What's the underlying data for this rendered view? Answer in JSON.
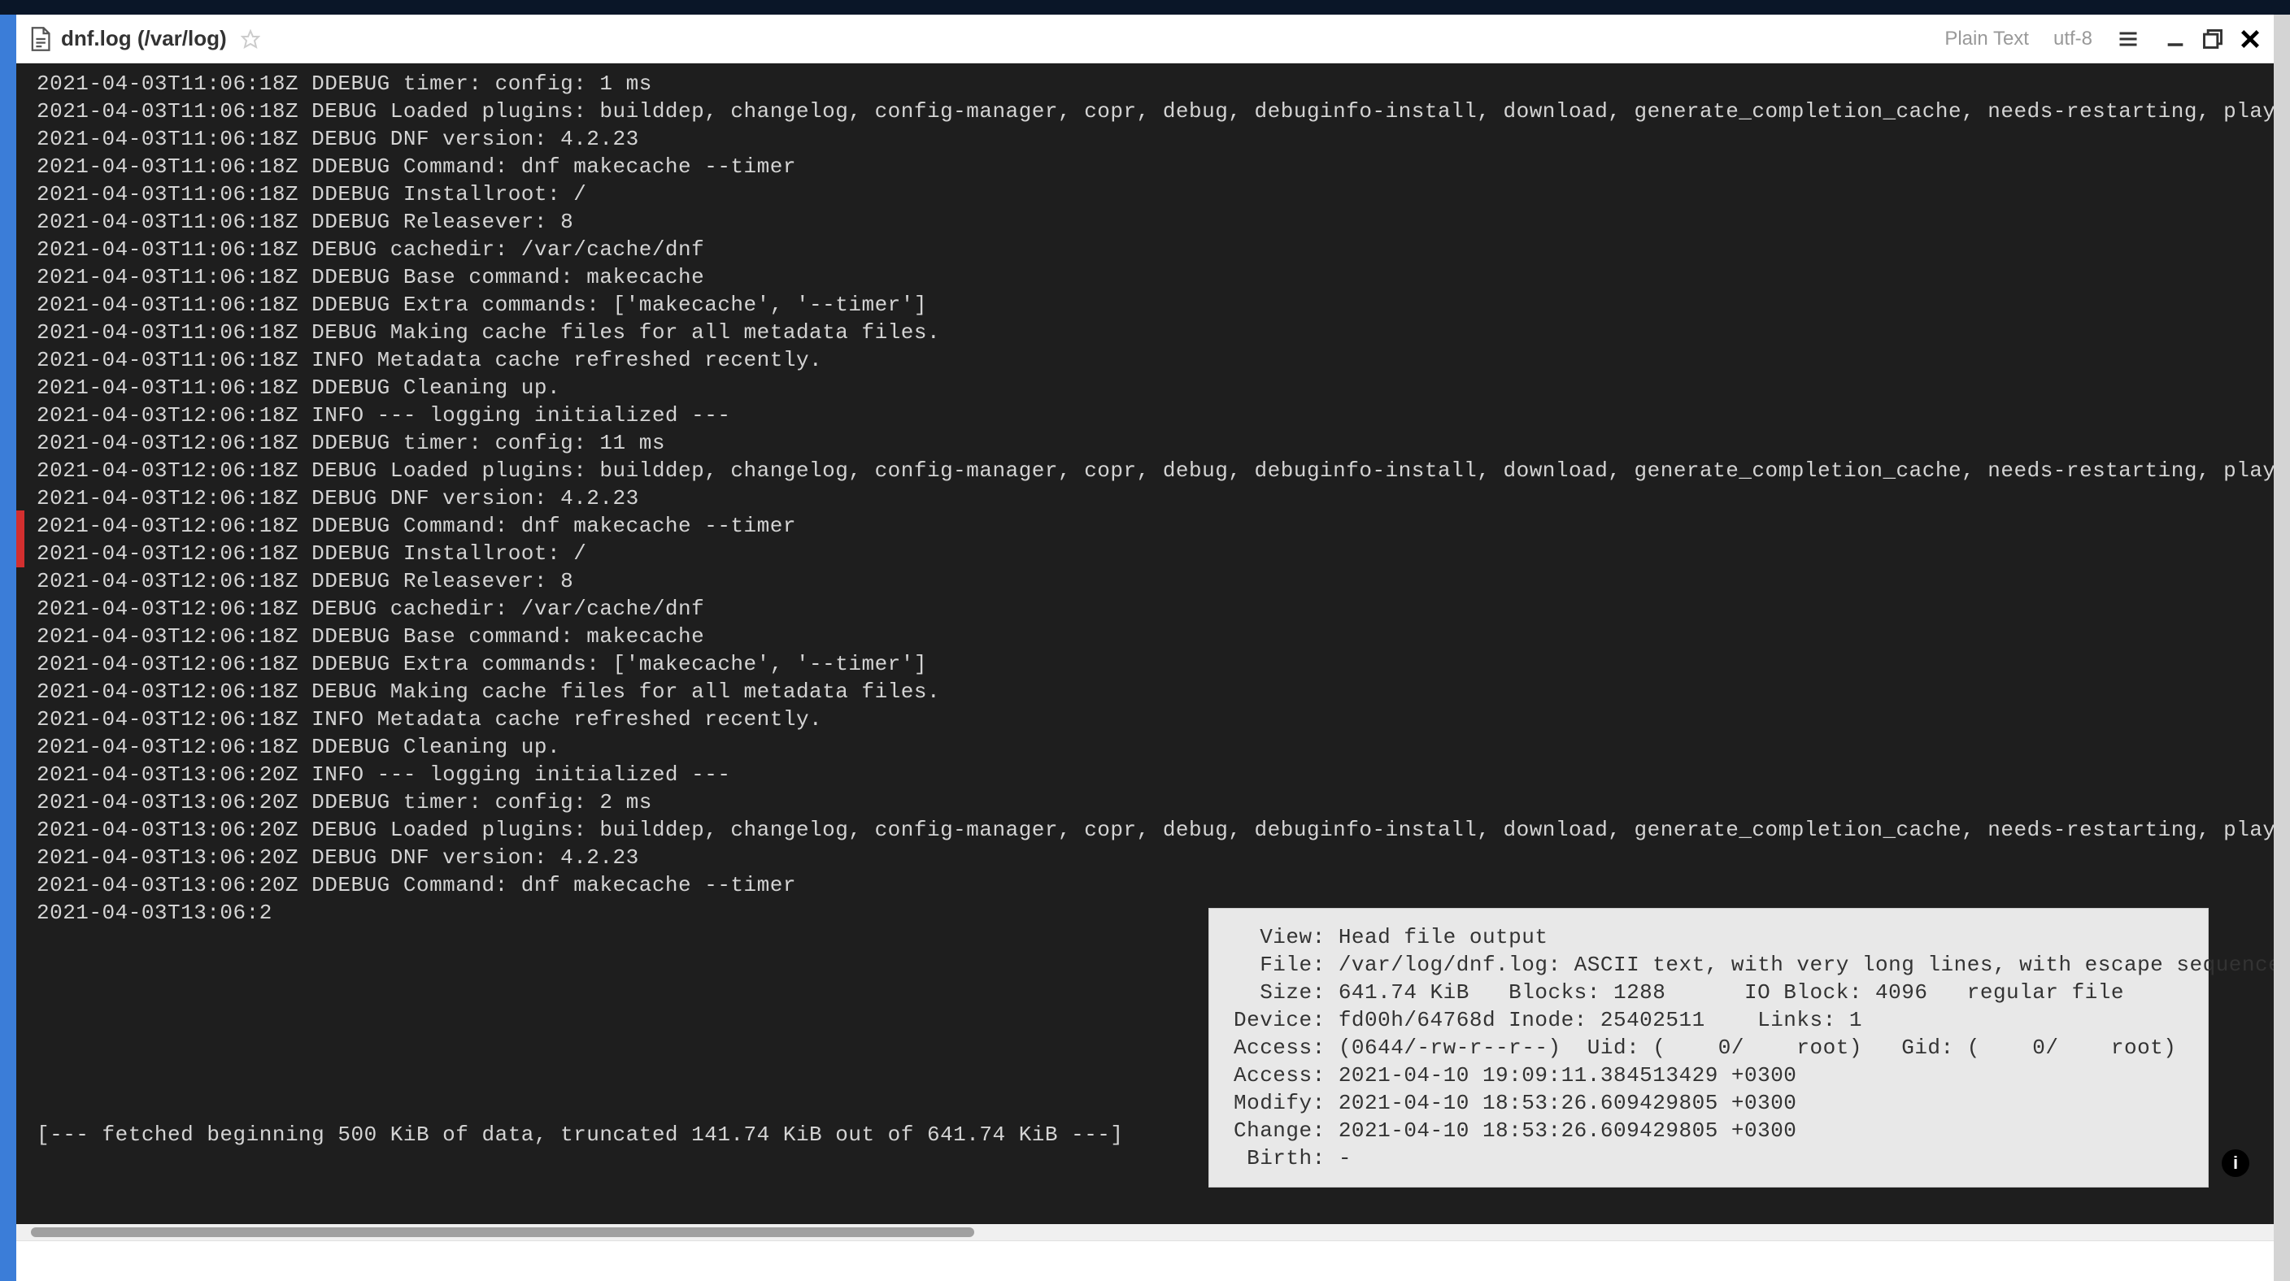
{
  "titlebar": {
    "filename": "dnf.log (/var/log)",
    "plaintext_label": "Plain Text",
    "encoding_label": "utf-8"
  },
  "log_lines": [
    "2021-04-03T11:06:18Z DDEBUG timer: config: 1 ms",
    "2021-04-03T11:06:18Z DEBUG Loaded plugins: builddep, changelog, config-manager, copr, debug, debuginfo-install, download, generate_completion_cache, needs-restarting, playground, repoclosure",
    "2021-04-03T11:06:18Z DEBUG DNF version: 4.2.23",
    "2021-04-03T11:06:18Z DDEBUG Command: dnf makecache --timer",
    "2021-04-03T11:06:18Z DDEBUG Installroot: /",
    "2021-04-03T11:06:18Z DDEBUG Releasever: 8",
    "2021-04-03T11:06:18Z DEBUG cachedir: /var/cache/dnf",
    "2021-04-03T11:06:18Z DDEBUG Base command: makecache",
    "2021-04-03T11:06:18Z DDEBUG Extra commands: ['makecache', '--timer']",
    "2021-04-03T11:06:18Z DEBUG Making cache files for all metadata files.",
    "2021-04-03T11:06:18Z INFO Metadata cache refreshed recently.",
    "2021-04-03T11:06:18Z DDEBUG Cleaning up.",
    "2021-04-03T12:06:18Z INFO --- logging initialized ---",
    "2021-04-03T12:06:18Z DDEBUG timer: config: 11 ms",
    "2021-04-03T12:06:18Z DEBUG Loaded plugins: builddep, changelog, config-manager, copr, debug, debuginfo-install, download, generate_completion_cache, needs-restarting, playground, repoclosure",
    "2021-04-03T12:06:18Z DEBUG DNF version: 4.2.23",
    "2021-04-03T12:06:18Z DDEBUG Command: dnf makecache --timer",
    "2021-04-03T12:06:18Z DDEBUG Installroot: /",
    "2021-04-03T12:06:18Z DDEBUG Releasever: 8",
    "2021-04-03T12:06:18Z DEBUG cachedir: /var/cache/dnf",
    "2021-04-03T12:06:18Z DDEBUG Base command: makecache",
    "2021-04-03T12:06:18Z DDEBUG Extra commands: ['makecache', '--timer']",
    "2021-04-03T12:06:18Z DEBUG Making cache files for all metadata files.",
    "2021-04-03T12:06:18Z INFO Metadata cache refreshed recently.",
    "2021-04-03T12:06:18Z DDEBUG Cleaning up.",
    "2021-04-03T13:06:20Z INFO --- logging initialized ---",
    "2021-04-03T13:06:20Z DDEBUG timer: config: 2 ms",
    "2021-04-03T13:06:20Z DEBUG Loaded plugins: builddep, changelog, config-manager, copr, debug, debuginfo-install, download, generate_completion_cache, needs-restarting, playground, repoclosure",
    "2021-04-03T13:06:20Z DEBUG DNF version: 4.2.23",
    "2021-04-03T13:06:20Z DDEBUG Command: dnf makecache --timer",
    "2021-04-03T13:06:2"
  ],
  "truncate_message": "[--- fetched beginning 500 KiB of data, truncated 141.74 KiB out of 641.74 KiB ---]",
  "info_panel": {
    "lines": [
      "  View: Head file output",
      "  File: /var/log/dnf.log: ASCII text, with very long lines, with escape sequences",
      "  Size: 641.74 KiB   Blocks: 1288      IO Block: 4096   regular file",
      "Device: fd00h/64768d Inode: 25402511    Links: 1",
      "Access: (0644/-rw-r--r--)  Uid: (    0/    root)   Gid: (    0/    root)",
      "Access: 2021-04-10 19:09:11.384513429 +0300",
      "Modify: 2021-04-10 18:53:26.609429805 +0300",
      "Change: 2021-04-10 18:53:26.609429805 +0300",
      " Birth: -"
    ]
  },
  "info_badge": "i"
}
